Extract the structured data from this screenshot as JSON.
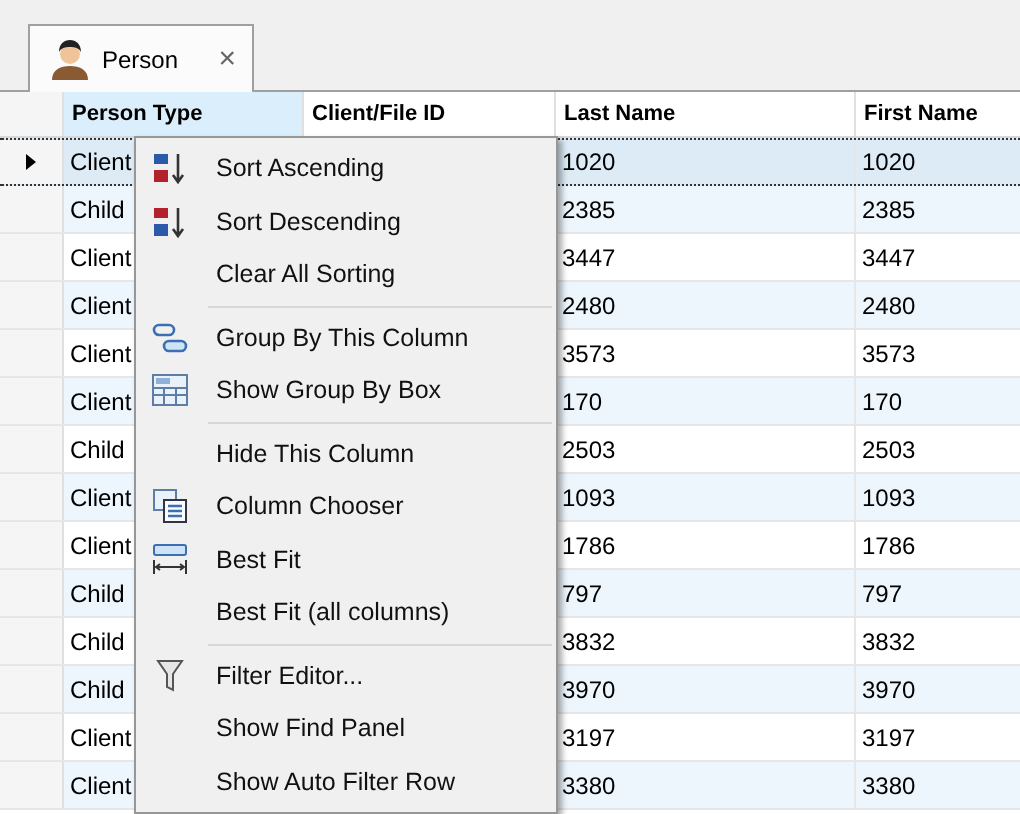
{
  "tab": {
    "label": "Person",
    "close": "×",
    "selected": true
  },
  "grid": {
    "columns": [
      "Person Type",
      "Client/File ID",
      "Last Name",
      "First Name"
    ],
    "rows": [
      {
        "selected": true,
        "person_type": "Client",
        "last_name": "1020",
        "first_name": "1020"
      },
      {
        "selected": false,
        "person_type": "Child",
        "last_name": "2385",
        "first_name": "2385"
      },
      {
        "selected": false,
        "person_type": "Client",
        "last_name": "3447",
        "first_name": "3447"
      },
      {
        "selected": false,
        "person_type": "Client",
        "last_name": "2480",
        "first_name": "2480"
      },
      {
        "selected": false,
        "person_type": "Client",
        "last_name": "3573",
        "first_name": "3573"
      },
      {
        "selected": false,
        "person_type": "Client",
        "last_name": "170",
        "first_name": "170"
      },
      {
        "selected": false,
        "person_type": "Child",
        "last_name": "2503",
        "first_name": "2503"
      },
      {
        "selected": false,
        "person_type": "Client",
        "last_name": "1093",
        "first_name": "1093"
      },
      {
        "selected": false,
        "person_type": "Client",
        "last_name": "1786",
        "first_name": "1786"
      },
      {
        "selected": false,
        "person_type": "Child",
        "last_name": "797",
        "first_name": "797"
      },
      {
        "selected": false,
        "person_type": "Child",
        "last_name": "3832",
        "first_name": "3832"
      },
      {
        "selected": false,
        "person_type": "Child",
        "last_name": "3970",
        "first_name": "3970"
      },
      {
        "selected": false,
        "person_type": "Client",
        "last_name": "3197",
        "first_name": "3197"
      },
      {
        "selected": false,
        "person_type": "Client",
        "last_name": "3380",
        "first_name": "3380"
      }
    ]
  },
  "context_menu": {
    "groups": [
      [
        {
          "label": "Sort Ascending"
        },
        {
          "label": "Sort Descending"
        },
        {
          "label": "Clear All Sorting"
        }
      ],
      [
        {
          "label": "Group By This Column"
        },
        {
          "label": "Show Group By Box"
        }
      ],
      [
        {
          "label": "Hide This Column"
        },
        {
          "label": "Column Chooser"
        },
        {
          "label": "Best Fit"
        },
        {
          "label": "Best Fit (all columns)"
        }
      ],
      [
        {
          "label": "Filter Editor..."
        },
        {
          "label": "Show Find Panel"
        },
        {
          "label": "Show Auto Filter Row"
        }
      ]
    ]
  }
}
